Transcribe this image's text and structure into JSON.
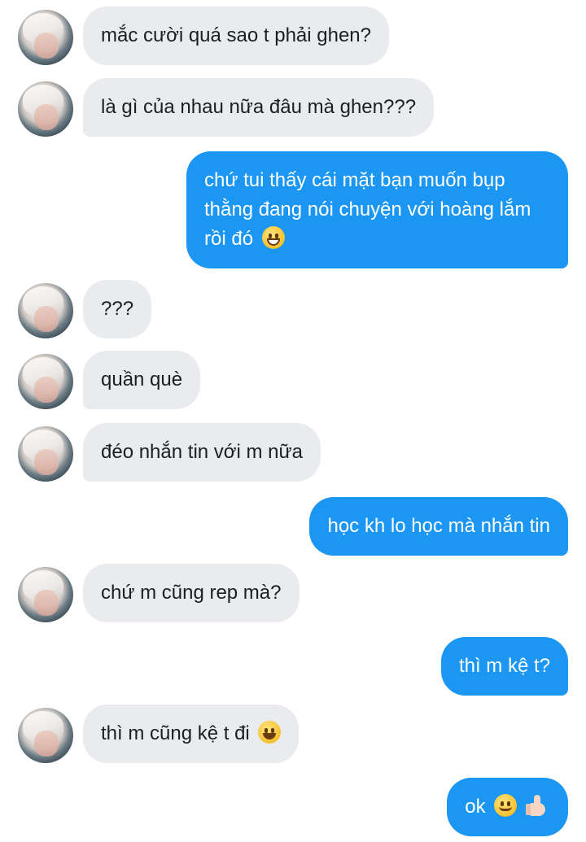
{
  "messages": [
    {
      "side": "in",
      "text": "mắc cười quá sao t phải ghen?"
    },
    {
      "side": "in",
      "text": "là gì của nhau nữa đâu mà ghen???"
    },
    {
      "side": "out",
      "text": "chứ tui thấy cái mặt bạn muốn bụp thằng đang nói chuyện với hoàng lắm rồi đó",
      "emoji": "grinning-face-with-smiling-eyes"
    },
    {
      "side": "in",
      "text": "???"
    },
    {
      "side": "in",
      "text": "quần què"
    },
    {
      "side": "in",
      "text": "đéo nhắn tin với m nữa"
    },
    {
      "side": "out",
      "text": "học kh lo học mà nhắn tin"
    },
    {
      "side": "in",
      "text": "chứ m cũng rep mà?"
    },
    {
      "side": "out",
      "text": "thì m kệ t?"
    },
    {
      "side": "in",
      "text": "thì m cũng kệ t đi",
      "emoji": "grinning-face"
    },
    {
      "side": "out",
      "text": "ok",
      "emoji": "smiling-face + thumbs-up"
    }
  ],
  "colors": {
    "incoming_bubble": "#e9ebee",
    "outgoing_bubble": "#1b96f2",
    "incoming_text": "#1c1e21",
    "outgoing_text": "#ffffff"
  }
}
